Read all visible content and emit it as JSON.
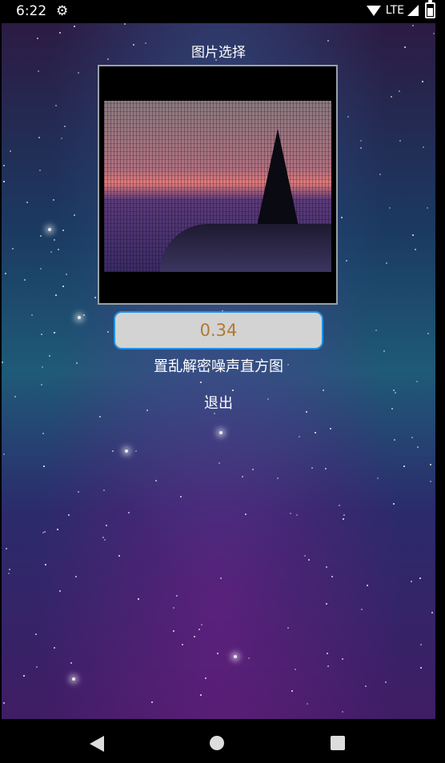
{
  "status": {
    "time": "6:22",
    "network": "LTE"
  },
  "app": {
    "title": "图片选择",
    "value": "0.34",
    "buttons": [
      {
        "label": "置乱解密噪声直方图"
      },
      {
        "label": "退出"
      }
    ]
  },
  "icons": {
    "settings": "gear-icon",
    "wifi": "wifi-icon",
    "signal": "signal-icon",
    "battery": "battery-icon",
    "nav_back": "back-icon",
    "nav_home": "home-icon",
    "nav_recents": "recents-icon"
  }
}
